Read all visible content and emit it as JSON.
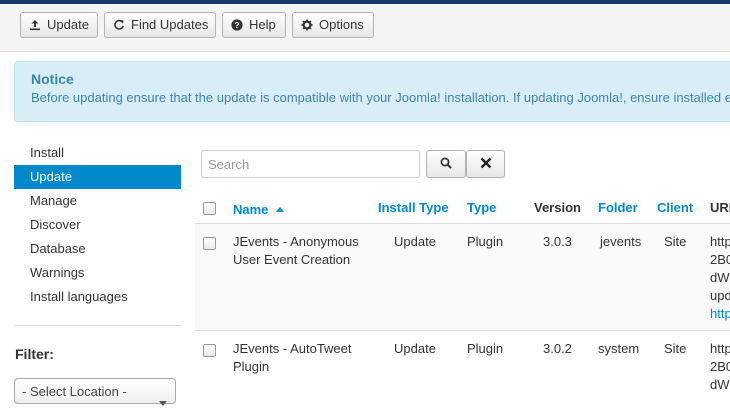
{
  "toolbar": {
    "update_label": "Update",
    "find_updates_label": "Find Updates",
    "help_label": "Help",
    "options_label": "Options"
  },
  "notice": {
    "title": "Notice",
    "text": "Before updating ensure that the update is compatible with your Joomla! installation. If updating Joomla!, ensure installed e"
  },
  "sidebar": {
    "items": [
      {
        "label": "Install"
      },
      {
        "label": "Update"
      },
      {
        "label": "Manage"
      },
      {
        "label": "Discover"
      },
      {
        "label": "Database"
      },
      {
        "label": "Warnings"
      },
      {
        "label": "Install languages"
      }
    ]
  },
  "filter": {
    "label": "Filter:",
    "location_select": "- Select Location -"
  },
  "search": {
    "placeholder": "Search"
  },
  "table": {
    "headers": {
      "name": "Name",
      "install_type": "Install Type",
      "type": "Type",
      "version": "Version",
      "folder": "Folder",
      "client": "Client",
      "url": "URL"
    },
    "rows": [
      {
        "name_line1": "JEvents - Anonymous",
        "name_line2": "User Event Creation",
        "install_type": "Update",
        "type": "Plugin",
        "version": "3.0.3",
        "folder": "jevents",
        "client": "Site",
        "url_lines": [
          "http",
          "2B0",
          "dW",
          "upd",
          "http"
        ]
      },
      {
        "name_line1": "JEvents - AutoTweet",
        "name_line2": "Plugin",
        "install_type": "Update",
        "type": "Plugin",
        "version": "3.0.2",
        "folder": "system",
        "client": "Site",
        "url_lines": [
          "http",
          "2B0",
          "dW"
        ]
      }
    ]
  },
  "colors": {
    "accent": "#0088cc",
    "notice_bg": "#d9edf7",
    "notice_text": "#3a87ad",
    "topbar": "#1a3867"
  }
}
